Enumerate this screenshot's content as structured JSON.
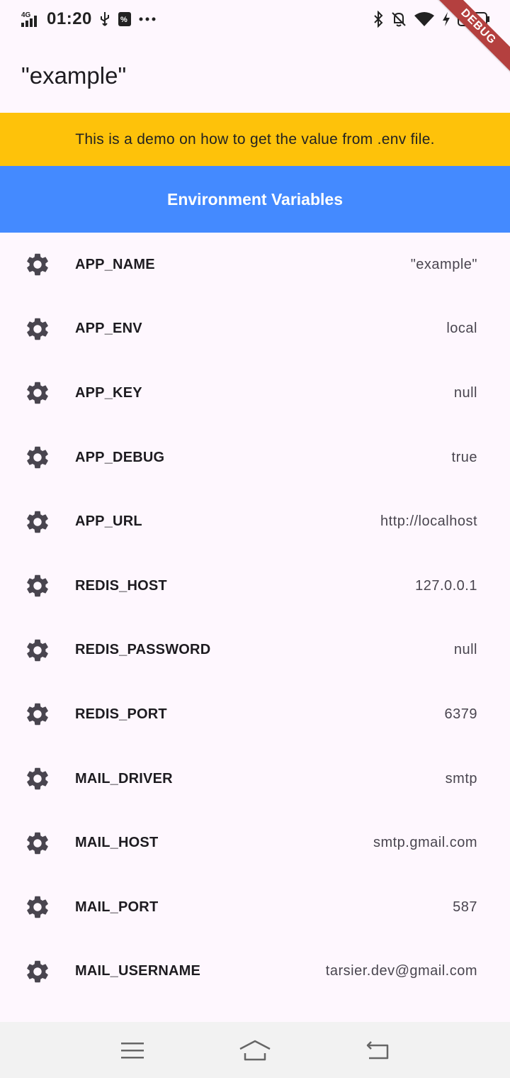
{
  "status_bar": {
    "network": "4G",
    "time": "01:20",
    "battery": "35",
    "icons": [
      "signal-icon",
      "usb-icon",
      "data-saver-icon",
      "more-icon",
      "bluetooth-icon",
      "bell-off-icon",
      "wifi-icon",
      "charging-icon",
      "battery-icon"
    ]
  },
  "debug_banner": "DEBUG",
  "app_bar": {
    "title": "\"example\""
  },
  "banner": {
    "text": "This is a demo on how to get the value from .env file.",
    "color": "#fec20a"
  },
  "section": {
    "title": "Environment Variables",
    "color": "#448aff"
  },
  "env_vars": [
    {
      "name": "APP_NAME",
      "value": "\"example\"",
      "icon": "gear-icon"
    },
    {
      "name": "APP_ENV",
      "value": "local",
      "icon": "gear-icon"
    },
    {
      "name": "APP_KEY",
      "value": "null",
      "icon": "gear-icon"
    },
    {
      "name": "APP_DEBUG",
      "value": "true",
      "icon": "gear-icon"
    },
    {
      "name": "APP_URL",
      "value": "http://localhost",
      "icon": "gear-icon"
    },
    {
      "name": "REDIS_HOST",
      "value": "127.0.0.1",
      "icon": "gear-icon"
    },
    {
      "name": "REDIS_PASSWORD",
      "value": "null",
      "icon": "gear-icon"
    },
    {
      "name": "REDIS_PORT",
      "value": "6379",
      "icon": "gear-icon"
    },
    {
      "name": "MAIL_DRIVER",
      "value": "smtp",
      "icon": "gear-icon"
    },
    {
      "name": "MAIL_HOST",
      "value": "smtp.gmail.com",
      "icon": "gear-icon"
    },
    {
      "name": "MAIL_PORT",
      "value": "587",
      "icon": "gear-icon"
    },
    {
      "name": "MAIL_USERNAME",
      "value": "tarsier.dev@gmail.com",
      "icon": "gear-icon"
    }
  ],
  "nav_bar": {
    "buttons": [
      "menu-icon",
      "home-icon",
      "back-icon"
    ]
  }
}
